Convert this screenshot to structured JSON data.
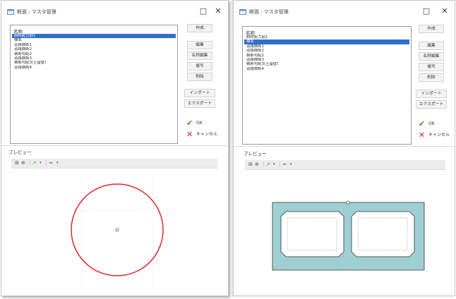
{
  "left_window": {
    "title": "断面 : マスタ管理",
    "minimize_glyph": "□",
    "close_glyph": "✕",
    "list": {
      "header": "名称",
      "items": [
        "斜材配力筋1",
        "標準",
        "道路横断1",
        "道路横断2",
        "横断勾配2",
        "道路横断3",
        "横断勾配3(土留壁)",
        "道路横断4"
      ],
      "selected_index": 0
    },
    "buttons": {
      "create": "作成",
      "edit": "編集",
      "rename": "名称編集",
      "copy": "複写",
      "delete": "削除",
      "import": "インポート",
      "export": "エクスポート"
    },
    "ok_label": "OK",
    "cancel_label": "キャンセル",
    "preview_label": "プレビュー",
    "preview_shape": "circle"
  },
  "right_window": {
    "title": "断面 : マスタ管理",
    "minimize_glyph": "□",
    "close_glyph": "✕",
    "list": {
      "header": "名称",
      "items": [
        "斜材配力筋1",
        "標準",
        "道路横断1",
        "道路横断2",
        "横断勾配2",
        "道路横断3",
        "横断勾配3(土留壁)",
        "道路横断4"
      ],
      "selected_index": 1
    },
    "buttons": {
      "create": "作成",
      "edit": "編集",
      "rename": "名称編集",
      "copy": "複写",
      "delete": "削除",
      "import": "インポート",
      "export": "エクスポート"
    },
    "ok_label": "OK",
    "cancel_label": "キャンセル",
    "preview_label": "プレビュー",
    "preview_shape": "double-box-culvert"
  },
  "icons": {
    "app": "app-window-icon",
    "zoom_fit": "zoom-fit-icon",
    "zoom": "zoom-icon",
    "pointer": "pointer-icon",
    "line_style": "line-style-icon",
    "ok": "checkmark-icon",
    "cancel": "cross-icon"
  },
  "colors": {
    "selection": "#2f6fcf",
    "circle_stroke": "#e0282a",
    "culvert_fill": "#9fcfd3",
    "culvert_stroke": "#333333",
    "ok_check": "#3b9a2a",
    "cancel_cross": "#d62828"
  }
}
